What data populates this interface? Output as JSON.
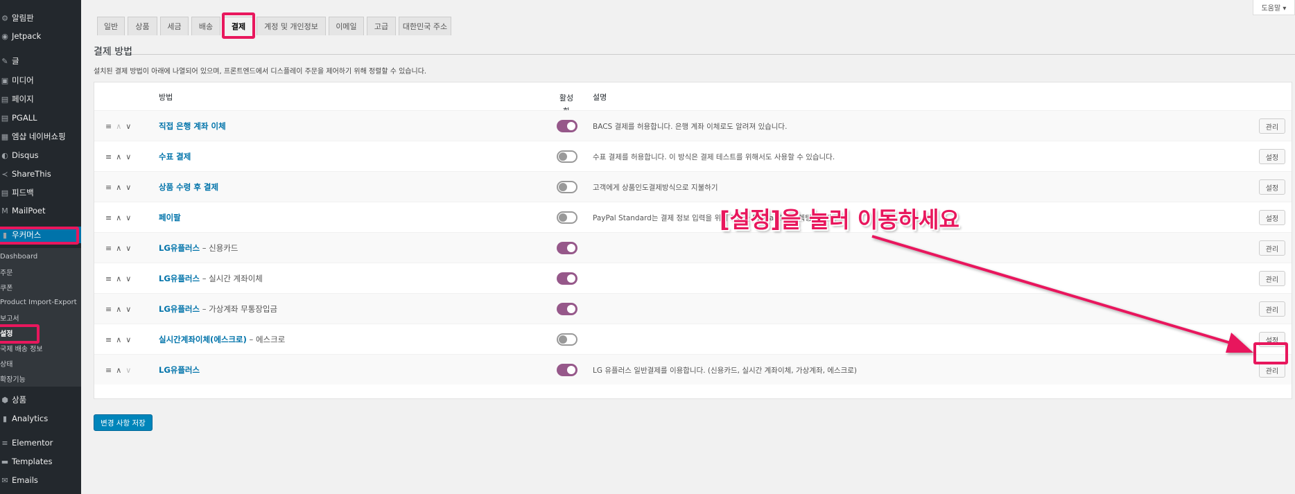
{
  "sidebar": {
    "menu": [
      {
        "icon": "bell-icon",
        "glyph": "⚙",
        "label": "알림판"
      },
      {
        "icon": "jetpack-icon",
        "glyph": "◉",
        "label": "Jetpack"
      },
      {
        "icon": "pin-icon",
        "glyph": "✎",
        "label": "글"
      },
      {
        "icon": "media-icon",
        "glyph": "▣",
        "label": "미디어"
      },
      {
        "icon": "page-icon",
        "glyph": "▤",
        "label": "페이지"
      },
      {
        "icon": "pgall-icon",
        "glyph": "▤",
        "label": "PGALL"
      },
      {
        "icon": "shop-icon",
        "glyph": "▦",
        "label": "엠샵 네이버쇼핑"
      },
      {
        "icon": "disqus-icon",
        "glyph": "◐",
        "label": "Disqus"
      },
      {
        "icon": "share-icon",
        "glyph": "≺",
        "label": "ShareThis"
      },
      {
        "icon": "feedback-icon",
        "glyph": "▤",
        "label": "피드백"
      },
      {
        "icon": "mailpoet-icon",
        "glyph": "M",
        "label": "MailPoet"
      },
      {
        "icon": "woo-icon",
        "glyph": "▮",
        "label": "우커머스"
      }
    ],
    "submenu": [
      "Dashboard",
      "주문",
      "쿠폰",
      "Product Import-Export",
      "보고서",
      "설정",
      "국제 배송 정보",
      "상태",
      "확장기능"
    ],
    "menu_bottom": [
      {
        "icon": "product-icon",
        "glyph": "⬢",
        "label": "상품"
      },
      {
        "icon": "analytics-icon",
        "glyph": "▮",
        "label": "Analytics"
      },
      {
        "icon": "elementor-icon",
        "glyph": "≡",
        "label": "Elementor"
      },
      {
        "icon": "templates-icon",
        "glyph": "▬",
        "label": "Templates"
      },
      {
        "icon": "emails-icon",
        "glyph": "✉",
        "label": "Emails"
      }
    ]
  },
  "help_label": "도움말 ▾",
  "tabs": [
    "일반",
    "상품",
    "세금",
    "배송",
    "결제",
    "계정 및 개인정보",
    "이메일",
    "고급",
    "대한민국 주소"
  ],
  "active_tab": "결제",
  "section": {
    "title": "결제 방법",
    "description": "설치된 결제 방법이 아래에 나열되어 있으며, 프론트엔드에서 디스플레이 주문을 제어하기 위해 정렬할 수 있습니다."
  },
  "table": {
    "headers": {
      "method": "방법",
      "enabled": "활성화",
      "description": "설명"
    },
    "rows": [
      {
        "name": "직접 은행 계좌 이체",
        "suffix": "",
        "enabled": true,
        "description": "BACS 결제를 허용합니다. 은행 계좌 이체로도 알려져 있습니다.",
        "action": "관리"
      },
      {
        "name": "수표 결제",
        "suffix": "",
        "enabled": false,
        "description": "수표 결제를 허용합니다. 이 방식은 결제 테스트를 위해서도 사용할 수 있습니다.",
        "action": "설정"
      },
      {
        "name": "상품 수령 후 결제",
        "suffix": "",
        "enabled": false,
        "description": "고객에게 상품인도결제방식으로 지불하기",
        "action": "설정"
      },
      {
        "name": "페이팔",
        "suffix": "",
        "enabled": false,
        "description": "PayPal Standard는 결제 정보 입력을 위해 고객을 PayPal로 리디렉팅합니다.",
        "action": "설정"
      },
      {
        "name": "LG유플러스",
        "suffix": " – 신용카드",
        "enabled": true,
        "description": "",
        "action": "관리"
      },
      {
        "name": "LG유플러스",
        "suffix": " – 실시간 계좌이체",
        "enabled": true,
        "description": "",
        "action": "관리"
      },
      {
        "name": "LG유플러스",
        "suffix": " – 가상계좌 무통장입금",
        "enabled": true,
        "description": "",
        "action": "관리"
      },
      {
        "name": "실시간계좌이체(에스크로)",
        "suffix": " – 에스크로",
        "enabled": false,
        "description": "",
        "action": "설정"
      },
      {
        "name": "LG유플러스",
        "suffix": "",
        "enabled": true,
        "description": "LG 유플러스 일반결제를 이용합니다. (신용카드, 실시간 계좌이체, 가상계좌, 에스크로)",
        "action": "관리"
      }
    ]
  },
  "save_label": "변경 사항 저장",
  "annotation": {
    "text": "[설정]을 눌러 이동하세요",
    "color": "#e8175d"
  },
  "colors": {
    "sidebar": "#23282d",
    "accent": "#0073aa",
    "toggle_on": "#96588a",
    "highlight": "#e8175d"
  }
}
